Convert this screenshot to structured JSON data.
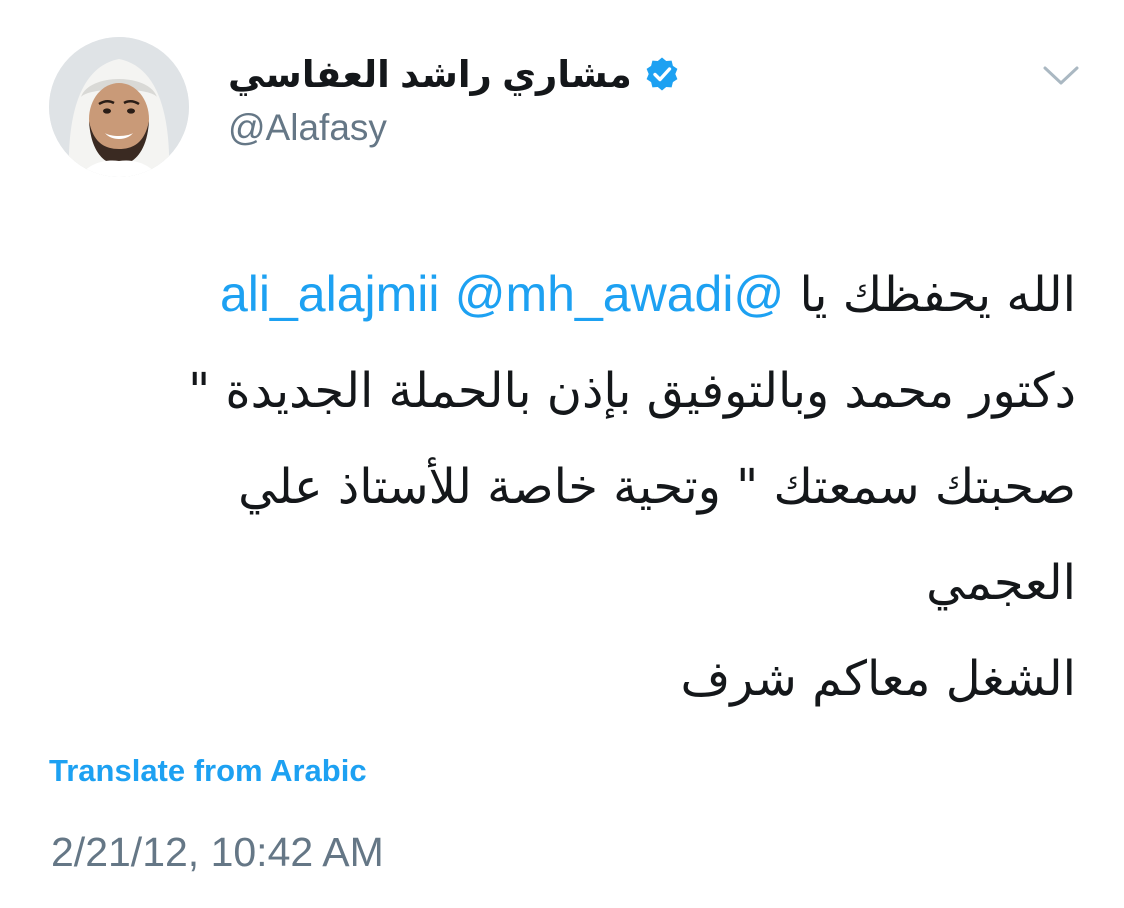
{
  "user": {
    "display_name": "مشاري راشد العفاسي",
    "handle": "@Alafasy",
    "verified": true,
    "avatar_icon": "user-avatar"
  },
  "tweet": {
    "line1_text": "الله يحفظك يا ",
    "mention1": "@ali_alajmii",
    "mention2": "@mh_awadi",
    "line2": "دكتور محمد وبالتوفيق بإذن بالحملة الجديدة \"",
    "line3": "صحبتك سمعتك \" وتحية خاصة للأستاذ علي",
    "line4": "العجمي",
    "line5": "الشغل معاكم شرف"
  },
  "translate_label": "Translate from Arabic",
  "timestamp": "2/21/12, 10:42 AM",
  "icons": {
    "verified": "verified-badge-icon",
    "menu": "chevron-down-icon"
  },
  "colors": {
    "link": "#1da1f2",
    "secondary_text": "#657786",
    "primary_text": "#14171a"
  }
}
